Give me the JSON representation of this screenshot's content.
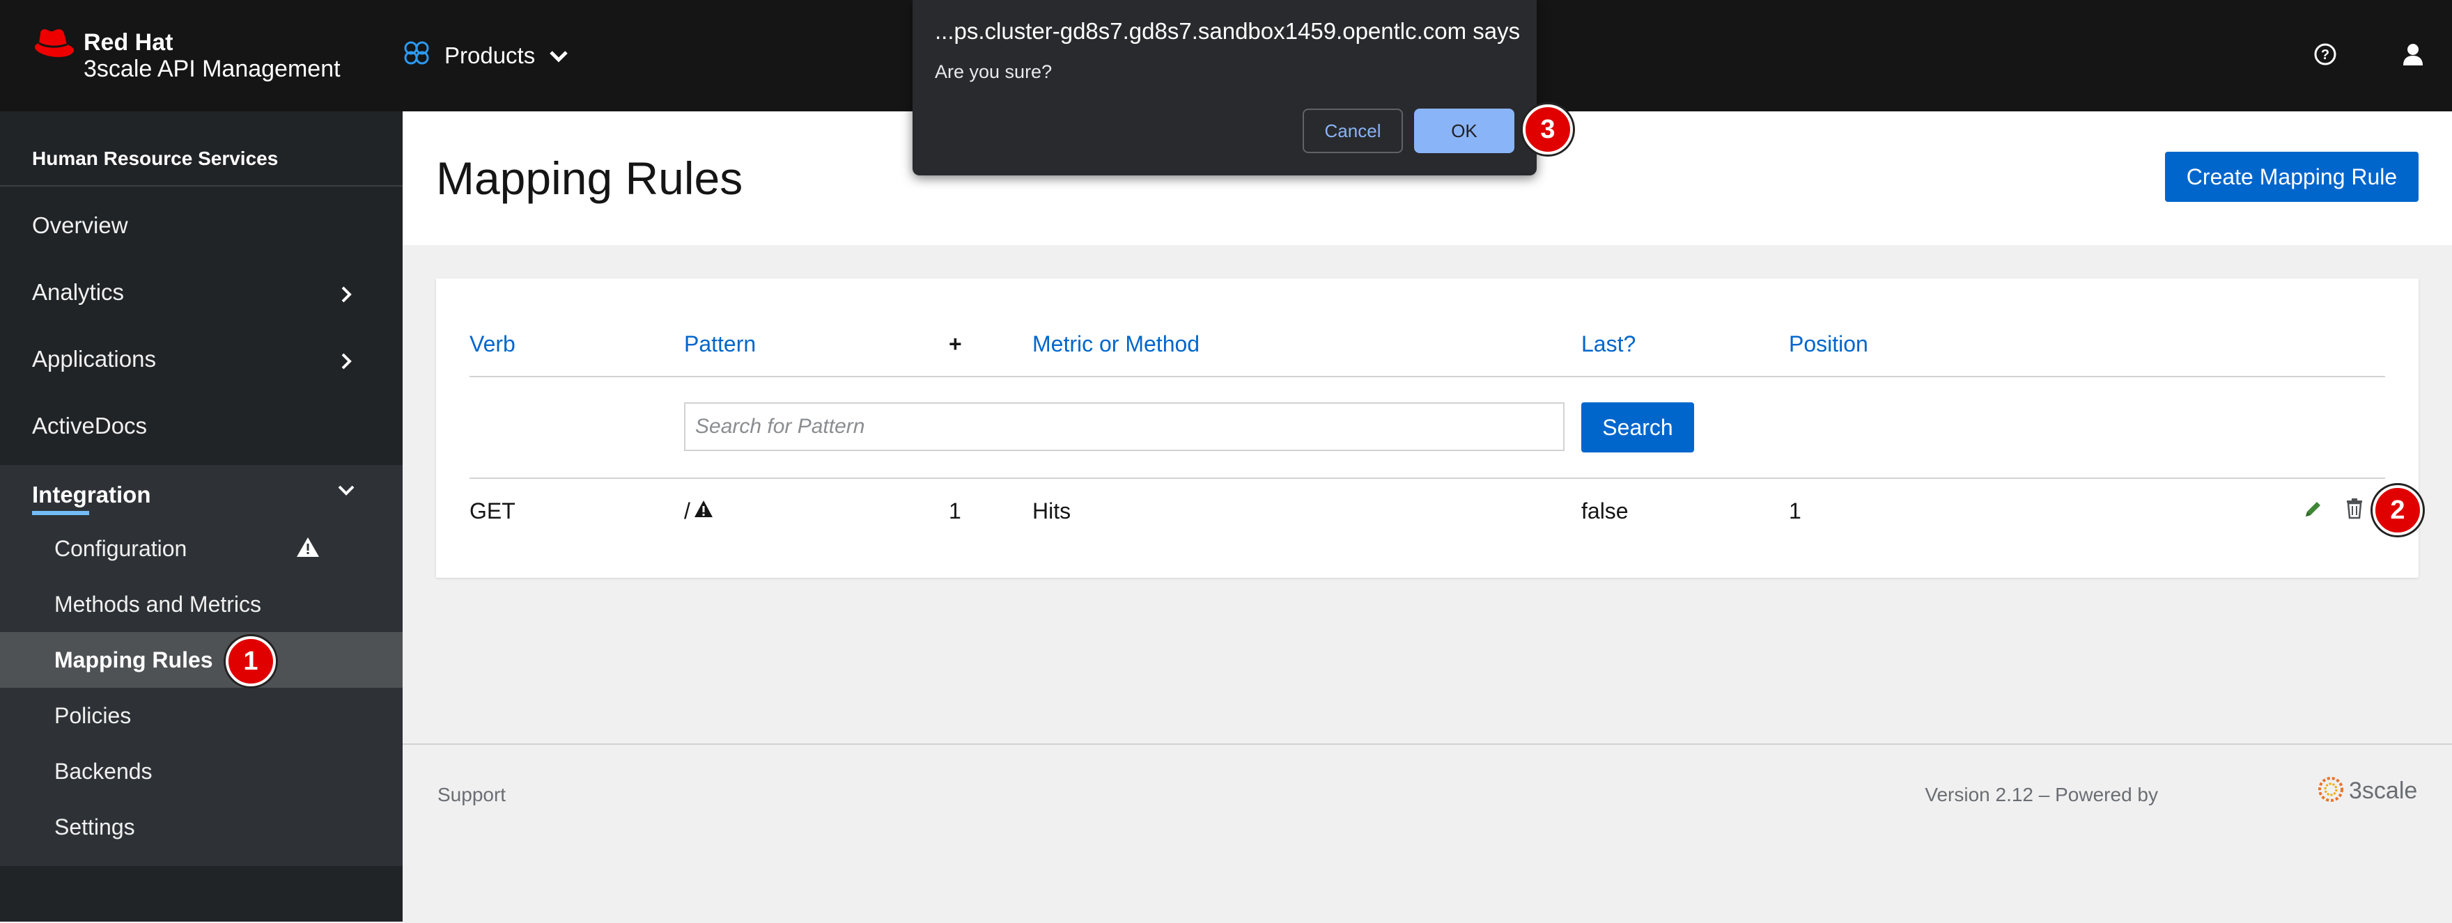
{
  "brand": {
    "line1": "Red Hat",
    "line2": "3scale API Management",
    "icon": "red-hat-logo"
  },
  "topbar": {
    "context_selector": "Products",
    "help_icon": "help-icon",
    "user_icon": "user-icon"
  },
  "sidebar": {
    "context": "Human Resource Services",
    "items": [
      {
        "label": "Overview"
      },
      {
        "label": "Analytics",
        "icon": "chevron-right-icon"
      },
      {
        "label": "Applications",
        "icon": "chevron-right-icon"
      },
      {
        "label": "ActiveDocs"
      }
    ],
    "group": {
      "label": "Integration",
      "expanded": true,
      "items": [
        {
          "label": "Configuration",
          "icon": "warning-icon"
        },
        {
          "label": "Methods and Metrics"
        },
        {
          "label": "Mapping Rules",
          "active": true
        },
        {
          "label": "Policies"
        },
        {
          "label": "Backends"
        },
        {
          "label": "Settings"
        }
      ]
    }
  },
  "main": {
    "title": "Mapping Rules",
    "create_button": "Create Mapping Rule",
    "table": {
      "columns": [
        "Verb",
        "Pattern",
        "+",
        "Metric or Method",
        "Last?",
        "Position"
      ],
      "search_placeholder": "Search for Pattern",
      "search_button": "Search",
      "rows": [
        {
          "verb": "GET",
          "pattern": "/",
          "plus": "1",
          "metric": "Hits",
          "last": "false",
          "position": "1"
        }
      ]
    }
  },
  "footer": {
    "support": "Support",
    "version": "Version 2.12 – Powered by",
    "logo_text": "3scale"
  },
  "dialog": {
    "title": "...ps.cluster-gd8s7.gd8s7.sandbox1459.opentlc.com says",
    "message": "Are you sure?",
    "cancel": "Cancel",
    "ok": "OK"
  },
  "markers": [
    "1",
    "2",
    "3"
  ],
  "colors": {
    "accent": "#0066cc",
    "marker": "#e00000",
    "edit": "#3e8635"
  }
}
